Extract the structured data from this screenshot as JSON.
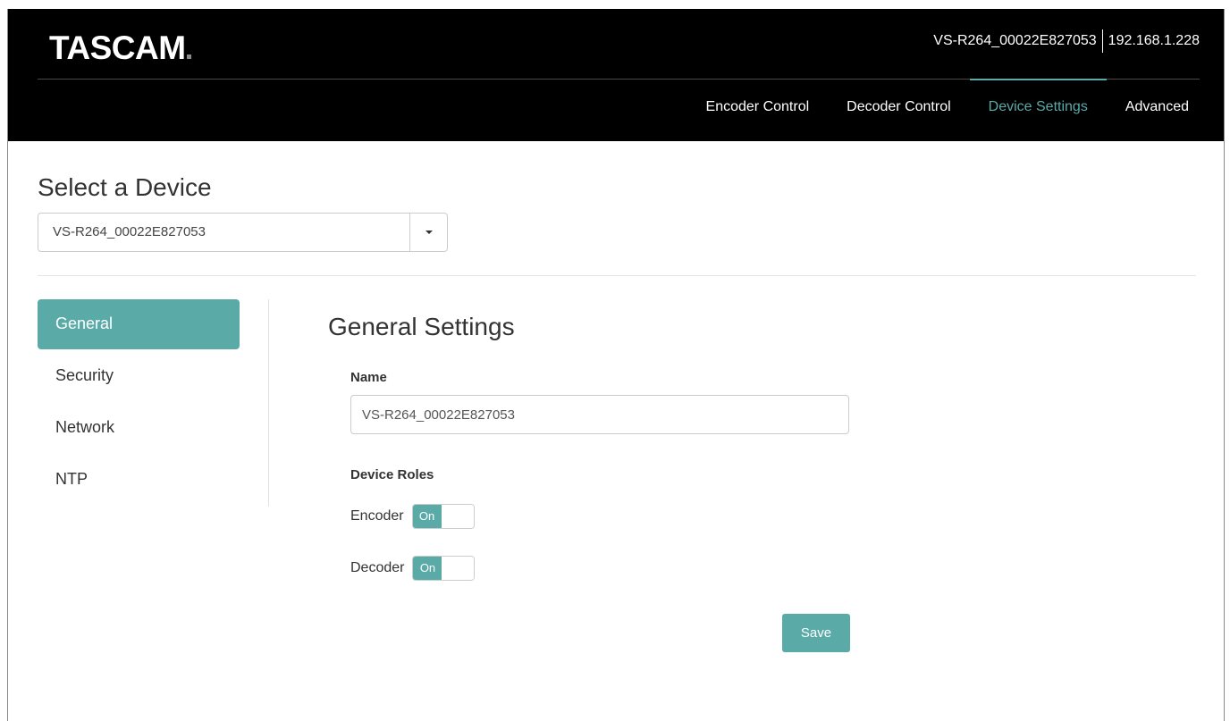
{
  "header": {
    "logo": "TASCAM",
    "device_name": "VS-R264_00022E827053",
    "ip_address": "192.168.1.228"
  },
  "nav": {
    "items": [
      {
        "label": "Encoder Control",
        "active": false
      },
      {
        "label": "Decoder Control",
        "active": false
      },
      {
        "label": "Device Settings",
        "active": true
      },
      {
        "label": "Advanced",
        "active": false
      }
    ]
  },
  "device_select": {
    "title": "Select a Device",
    "selected": "VS-R264_00022E827053"
  },
  "sidebar": {
    "items": [
      {
        "label": "General",
        "active": true
      },
      {
        "label": "Security",
        "active": false
      },
      {
        "label": "Network",
        "active": false
      },
      {
        "label": "NTP",
        "active": false
      }
    ]
  },
  "general_settings": {
    "title": "General Settings",
    "name_label": "Name",
    "name_value": "VS-R264_00022E827053",
    "roles_label": "Device Roles",
    "roles": [
      {
        "label": "Encoder",
        "state": "On"
      },
      {
        "label": "Decoder",
        "state": "On"
      }
    ],
    "save_label": "Save"
  },
  "colors": {
    "accent": "#5aaaa8",
    "topbar": "#000000"
  }
}
